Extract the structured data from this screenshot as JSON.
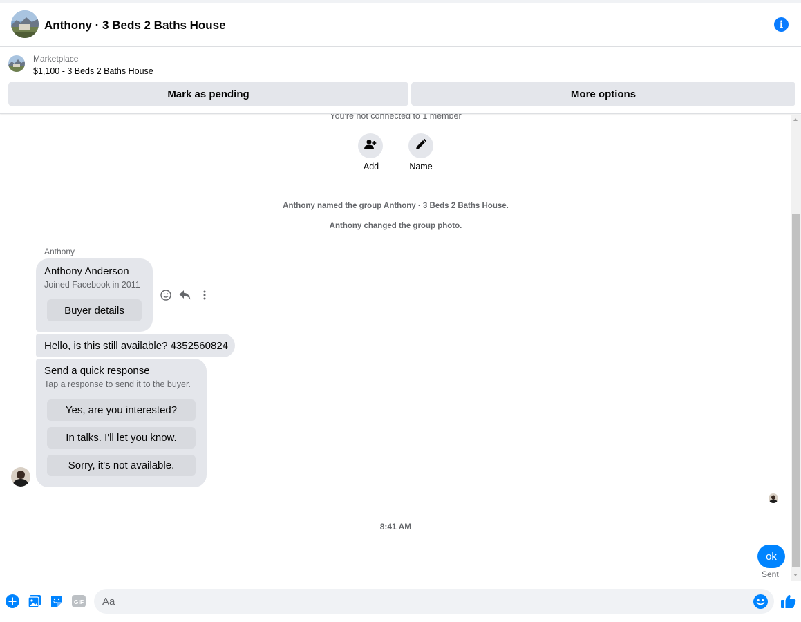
{
  "header": {
    "title": "Anthony · 3 Beds 2 Baths House",
    "info_icon": "info-icon"
  },
  "marketplace": {
    "label": "Marketplace",
    "listing": "$1,100 - 3 Beds 2 Baths House",
    "mark_pending": "Mark as pending",
    "more_options": "More options"
  },
  "thread": {
    "not_connected": "You're not connected to 1 member",
    "actions": [
      {
        "label": "Add",
        "icon": "add-person-icon"
      },
      {
        "label": "Name",
        "icon": "pencil-icon"
      }
    ],
    "system_messages": [
      "Anthony named the group Anthony · 3 Beds 2 Baths House.",
      "Anthony changed the group photo."
    ],
    "sender": "Anthony",
    "buyer_card": {
      "name": "Anthony Anderson",
      "joined": "Joined Facebook in 2011",
      "button": "Buyer details"
    },
    "message": "Hello, is this still available?  4352560824",
    "quick_response": {
      "title": "Send a quick response",
      "subtitle": "Tap a response to send it to the buyer.",
      "options": [
        "Yes, are you interested?",
        "In talks. I'll let you know.",
        "Sorry, it's not available."
      ]
    },
    "timestamp": "8:41 AM",
    "my_message": "ok",
    "status": "Sent"
  },
  "composer": {
    "placeholder": "Aa",
    "icons": [
      "plus-icon",
      "photo-icon",
      "sticker-icon",
      "gif-icon",
      "emoji-icon",
      "thumbs-up-icon"
    ]
  },
  "colors": {
    "accent": "#0084ff",
    "bubble_gray": "#e4e6eb",
    "secondary_text": "#65676b"
  }
}
